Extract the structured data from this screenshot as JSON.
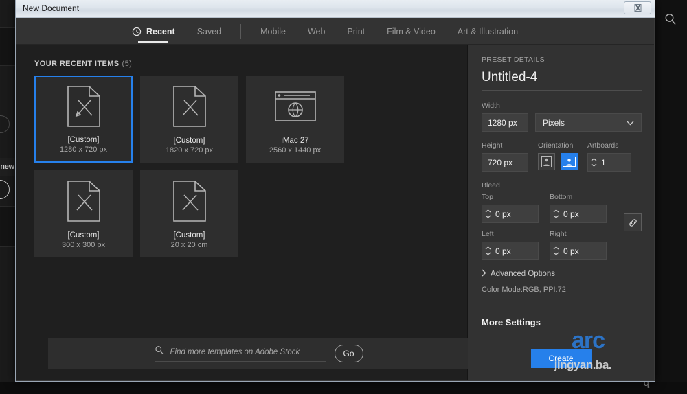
{
  "window": {
    "title": "New Document",
    "close_icon": "close-icon"
  },
  "tabs": [
    {
      "label": "Recent",
      "icon": "clock-icon",
      "active": true
    },
    {
      "label": "Saved",
      "active": false
    },
    {
      "label": "Mobile",
      "active": false
    },
    {
      "label": "Web",
      "active": false
    },
    {
      "label": "Print",
      "active": false
    },
    {
      "label": "Film & Video",
      "active": false
    },
    {
      "label": "Art & Illustration",
      "active": false
    }
  ],
  "recent": {
    "heading": "YOUR RECENT ITEMS",
    "count": "(5)",
    "items": [
      {
        "name": "[Custom]",
        "size": "1280 x 720 px",
        "icon": "document-artboard-icon",
        "selected": true
      },
      {
        "name": "[Custom]",
        "size": "1820 x 720 px",
        "icon": "document-artboard-icon",
        "selected": false
      },
      {
        "name": "iMac 27",
        "size": "2560 x 1440 px",
        "icon": "browser-globe-icon",
        "selected": false
      },
      {
        "name": "[Custom]",
        "size": "300 x 300 px",
        "icon": "document-artboard-icon",
        "selected": false
      },
      {
        "name": "[Custom]",
        "size": "20 x 20 cm",
        "icon": "document-artboard-icon",
        "selected": false
      }
    ]
  },
  "stock": {
    "placeholder": "Find more templates on Adobe Stock",
    "value": "",
    "search_icon": "search-icon",
    "go_label": "Go"
  },
  "preset": {
    "caption": "PRESET DETAILS",
    "name": "Untitled-4",
    "width_label": "Width",
    "width_value": "1280 px",
    "units_value": "Pixels",
    "height_label": "Height",
    "height_value": "720 px",
    "orientation_label": "Orientation",
    "orientation_selected": "landscape",
    "artboards_label": "Artboards",
    "artboards_value": "1",
    "bleed_label": "Bleed",
    "bleed": [
      {
        "label": "Top",
        "value": "0 px"
      },
      {
        "label": "Bottom",
        "value": "0 px"
      },
      {
        "label": "Left",
        "value": "0 px"
      },
      {
        "label": "Right",
        "value": "0 px"
      }
    ],
    "link_icon": "link-chain-icon",
    "advanced_label": "Advanced Options",
    "advanced_icon": "chevron-right-icon",
    "color_mode": "Color Mode:RGB, PPI:72",
    "more_settings": "More Settings",
    "create_label": "Create"
  },
  "watermark": {
    "big": "arc",
    "small": "jingyan.ba."
  },
  "background": {
    "new_label": "new",
    "search_icon": "search-icon",
    "corner_glyph": "զ"
  },
  "colors": {
    "accent": "#2680eb",
    "panel": "#323232",
    "content": "#1f1f1f",
    "tabbar": "#333333",
    "card": "#2e2e2e"
  }
}
